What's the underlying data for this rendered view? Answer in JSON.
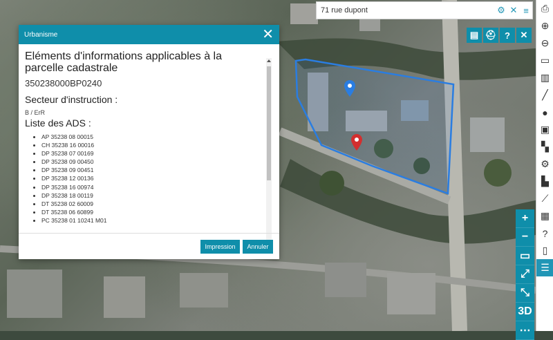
{
  "search": {
    "value": "71 rue dupont"
  },
  "dialog": {
    "title": "Urbanisme",
    "heading": "Eléments d'informations applicables à la parcelle cadastrale",
    "parcel_id": "350238000BP0240",
    "secteur_label": "Secteur d'instruction :",
    "secteur_value": "B / ErR",
    "ads_label": "Liste des ADS :",
    "ads_items": [
      "AP 35238 08 00015",
      "CH 35238 16 00016",
      "DP 35238 07 00169",
      "DP 35238 09 00450",
      "DP 35238 09 00451",
      "DP 35238 12 00136",
      "DP 35238 16 00974",
      "DP 35238 18 00119",
      "DT 35238 02 60009",
      "DT 35238 06 60899",
      "PC 35238 01 10241 M01"
    ],
    "print_button": "Impression",
    "cancel_button": "Annuler"
  },
  "navstack": {
    "three_d_label": "3D"
  },
  "colors": {
    "accent": "#0f8eaa",
    "parcel_outline": "#2a7de1",
    "marker_red": "#d32f2f",
    "marker_blue": "#2a7de1"
  }
}
